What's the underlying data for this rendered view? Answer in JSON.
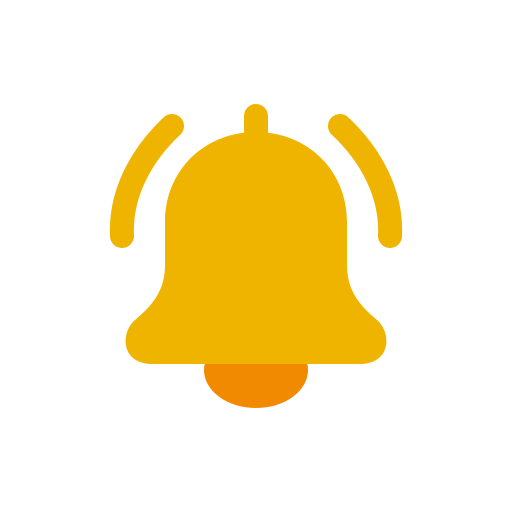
{
  "icon": {
    "name": "bell-icon",
    "colors": {
      "bell_body": "#EFB400",
      "bell_clapper": "#F18A00",
      "background": "#FFFFFF"
    }
  }
}
